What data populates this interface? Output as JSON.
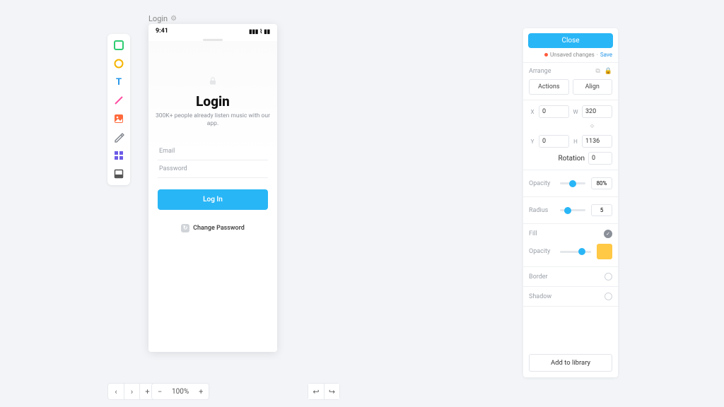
{
  "artboard": {
    "label": "Login"
  },
  "phone": {
    "time": "9:41",
    "title": "Login",
    "subtitle": "300K+ people already listen music with our app.",
    "email_placeholder": "Email",
    "password_placeholder": "Password",
    "login_btn": "Log In",
    "change_pw": "Change Password"
  },
  "bottom": {
    "zoom": "100%"
  },
  "panel": {
    "close": "Close",
    "unsaved": "Unsaved changes",
    "save": "Save",
    "arrange": "Arrange",
    "actions": "Actions",
    "align": "Align",
    "x_label": "X",
    "x": "0",
    "y_label": "Y",
    "y": "0",
    "w_label": "W",
    "w": "320",
    "h_label": "H",
    "h": "1136",
    "rotation_label": "Rotation",
    "rotation": "0",
    "opacity_label": "Opacity",
    "opacity": "80%",
    "radius_label": "Radius",
    "radius": "5",
    "fill_label": "Fill",
    "fill_opacity_label": "Opacity",
    "fill_color": "#ffc845",
    "border_label": "Border",
    "shadow_label": "Shadow",
    "add_lib": "Add to library"
  }
}
